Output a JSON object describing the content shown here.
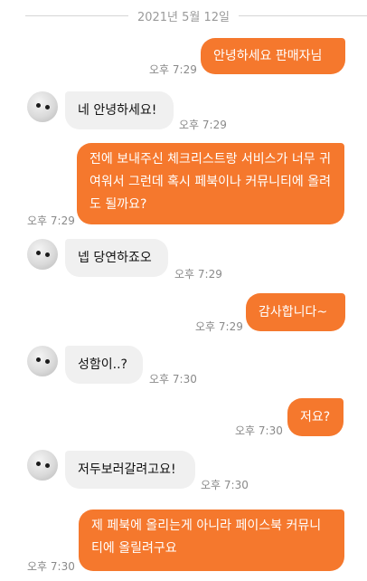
{
  "chat": {
    "date": "2021년 5월 12일",
    "messages": [
      {
        "direction": "out",
        "text": "안녕하세요 판매자님",
        "time": "오후 7:29"
      },
      {
        "direction": "in",
        "text": "네 안녕하세요!",
        "time": "오후 7:29"
      },
      {
        "direction": "out",
        "text": "전에 보내주신 체크리스트랑 서비스가 너무 귀여워서 그런데 혹시 페북이나 커뮤니티에 올려도 될까요?",
        "time": "오후 7:29"
      },
      {
        "direction": "in",
        "text": "넵 당연하죠오",
        "time": "오후 7:29"
      },
      {
        "direction": "out",
        "text": "감사합니다~",
        "time": "오후 7:29"
      },
      {
        "direction": "in",
        "text": "성함이..?",
        "time": "오후 7:30"
      },
      {
        "direction": "out",
        "text": "저요?",
        "time": "오후 7:30"
      },
      {
        "direction": "in",
        "text": "저두보러갈려고요!",
        "time": "오후 7:30"
      },
      {
        "direction": "out",
        "text": "제 페북에 올리는게 아니라 페이스북 커뮤니티에 올릴려구요",
        "time": "오후 7:30"
      }
    ]
  }
}
